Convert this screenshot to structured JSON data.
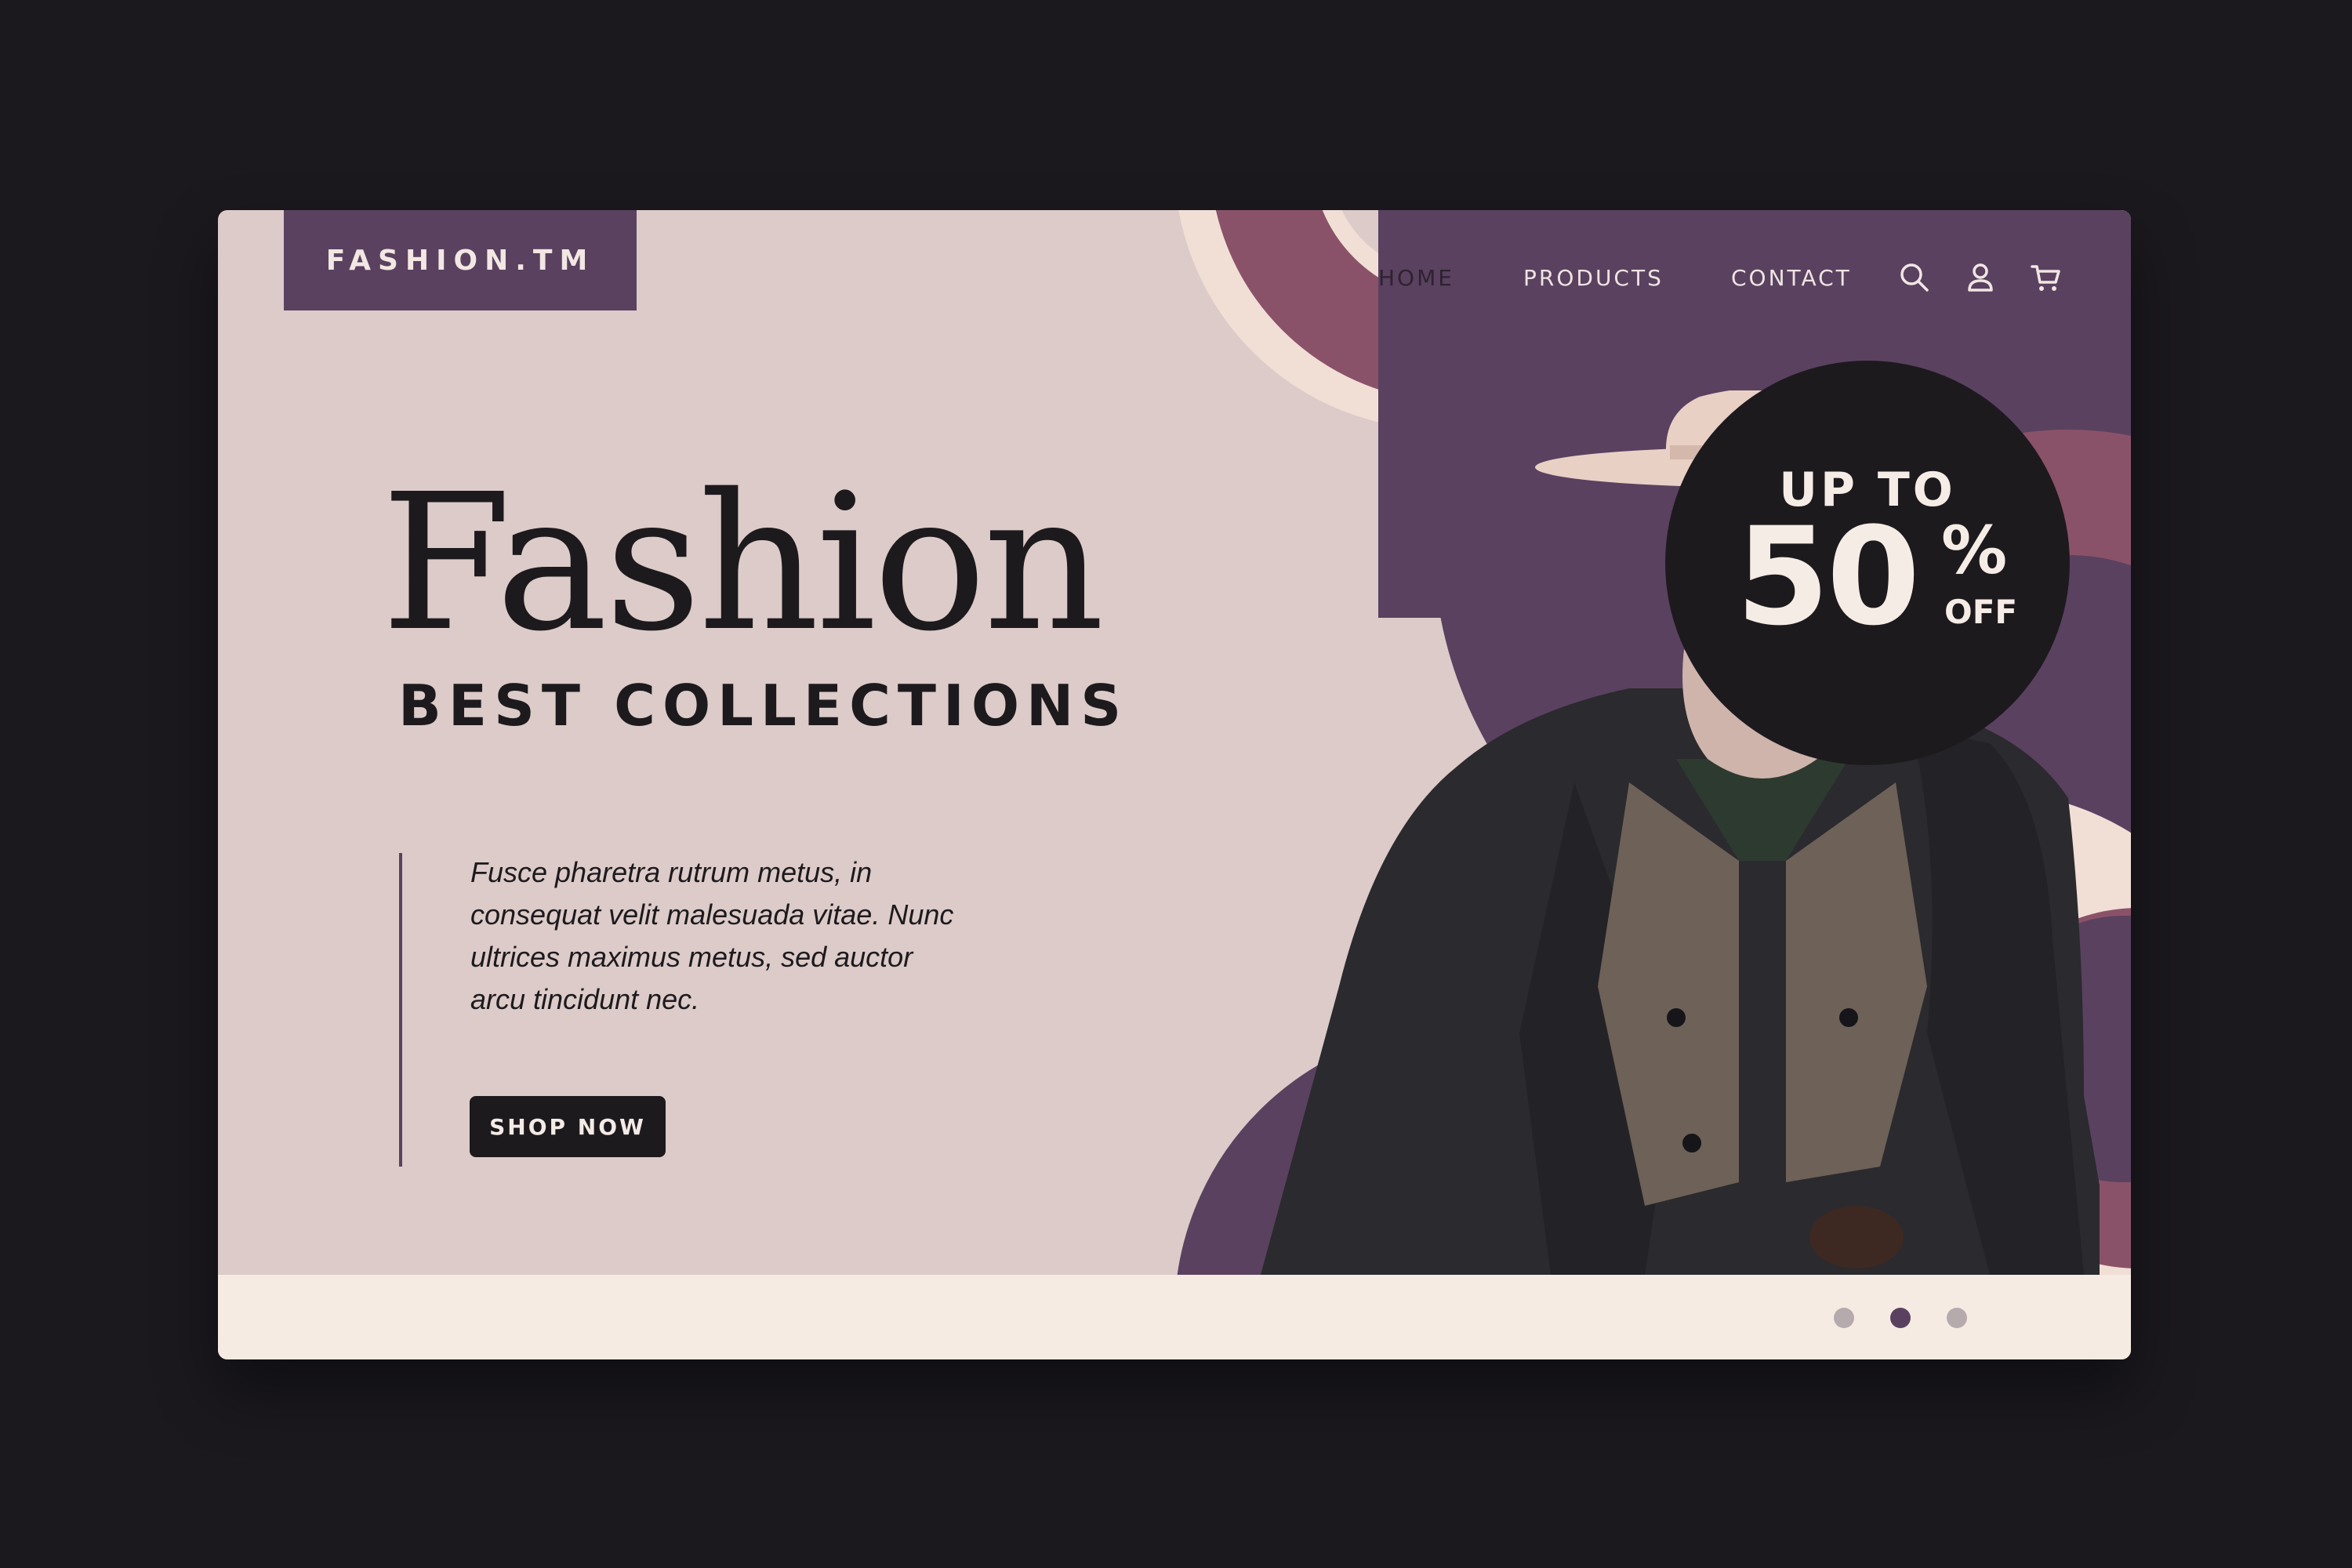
{
  "brand": {
    "logo": "FASHION.TM"
  },
  "nav": {
    "items": [
      "HOME",
      "PRODUCTS",
      "CONTACT"
    ],
    "active": "HOME",
    "icons": [
      "search-icon",
      "user-icon",
      "cart-icon"
    ]
  },
  "hero": {
    "title": "Fashion",
    "subtitle": "BEST COLLECTIONS",
    "description": "Fusce pharetra rutrum metus, in consequat velit malesuada vitae. Nunc ultrices maximus metus, sed auctor arcu tincidunt nec.",
    "cta": "SHOP NOW"
  },
  "promo": {
    "line1": "UP TO",
    "number": "50",
    "percent": "%",
    "off": "OFF"
  },
  "carousel": {
    "slides": 3,
    "active_slide": 2
  },
  "colors": {
    "background": "#1b191e",
    "card": "#dccbc8",
    "purple": "#5a4160",
    "mauve": "#8a5268",
    "cream": "#f1dfd6",
    "dark": "#1d1a1e",
    "footer": "#f6ebe3"
  }
}
